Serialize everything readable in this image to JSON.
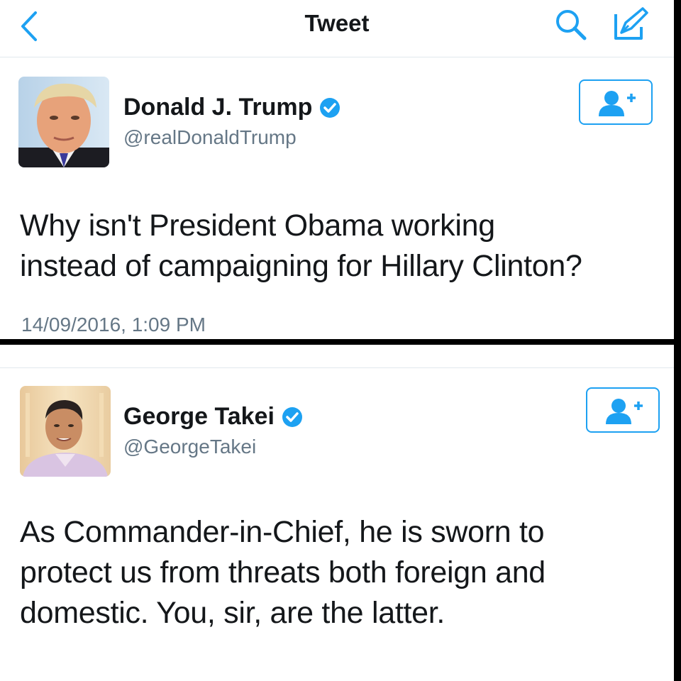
{
  "nav": {
    "title": "Tweet",
    "back_icon": "chevron-left-icon",
    "search_icon": "search-icon",
    "compose_icon": "compose-icon"
  },
  "tweets": [
    {
      "name": "Donald J. Trump",
      "handle": "@realDonaldTrump",
      "verified": true,
      "text_lines": [
        "Why isn't President Obama working",
        "instead of campaigning for Hillary Clinton?"
      ],
      "timestamp": "14/09/2016, 1:09 PM"
    },
    {
      "name": "George Takei",
      "handle": "@GeorgeTakei",
      "verified": true,
      "text_lines": [
        "As Commander-in-Chief, he is sworn to",
        "protect us from threats both foreign and",
        "domestic. You, sir, are the latter."
      ]
    }
  ],
  "colors": {
    "accent": "#1da1f2",
    "secondary_text": "#657786",
    "primary_text": "#14171a",
    "frame": "#000000"
  }
}
